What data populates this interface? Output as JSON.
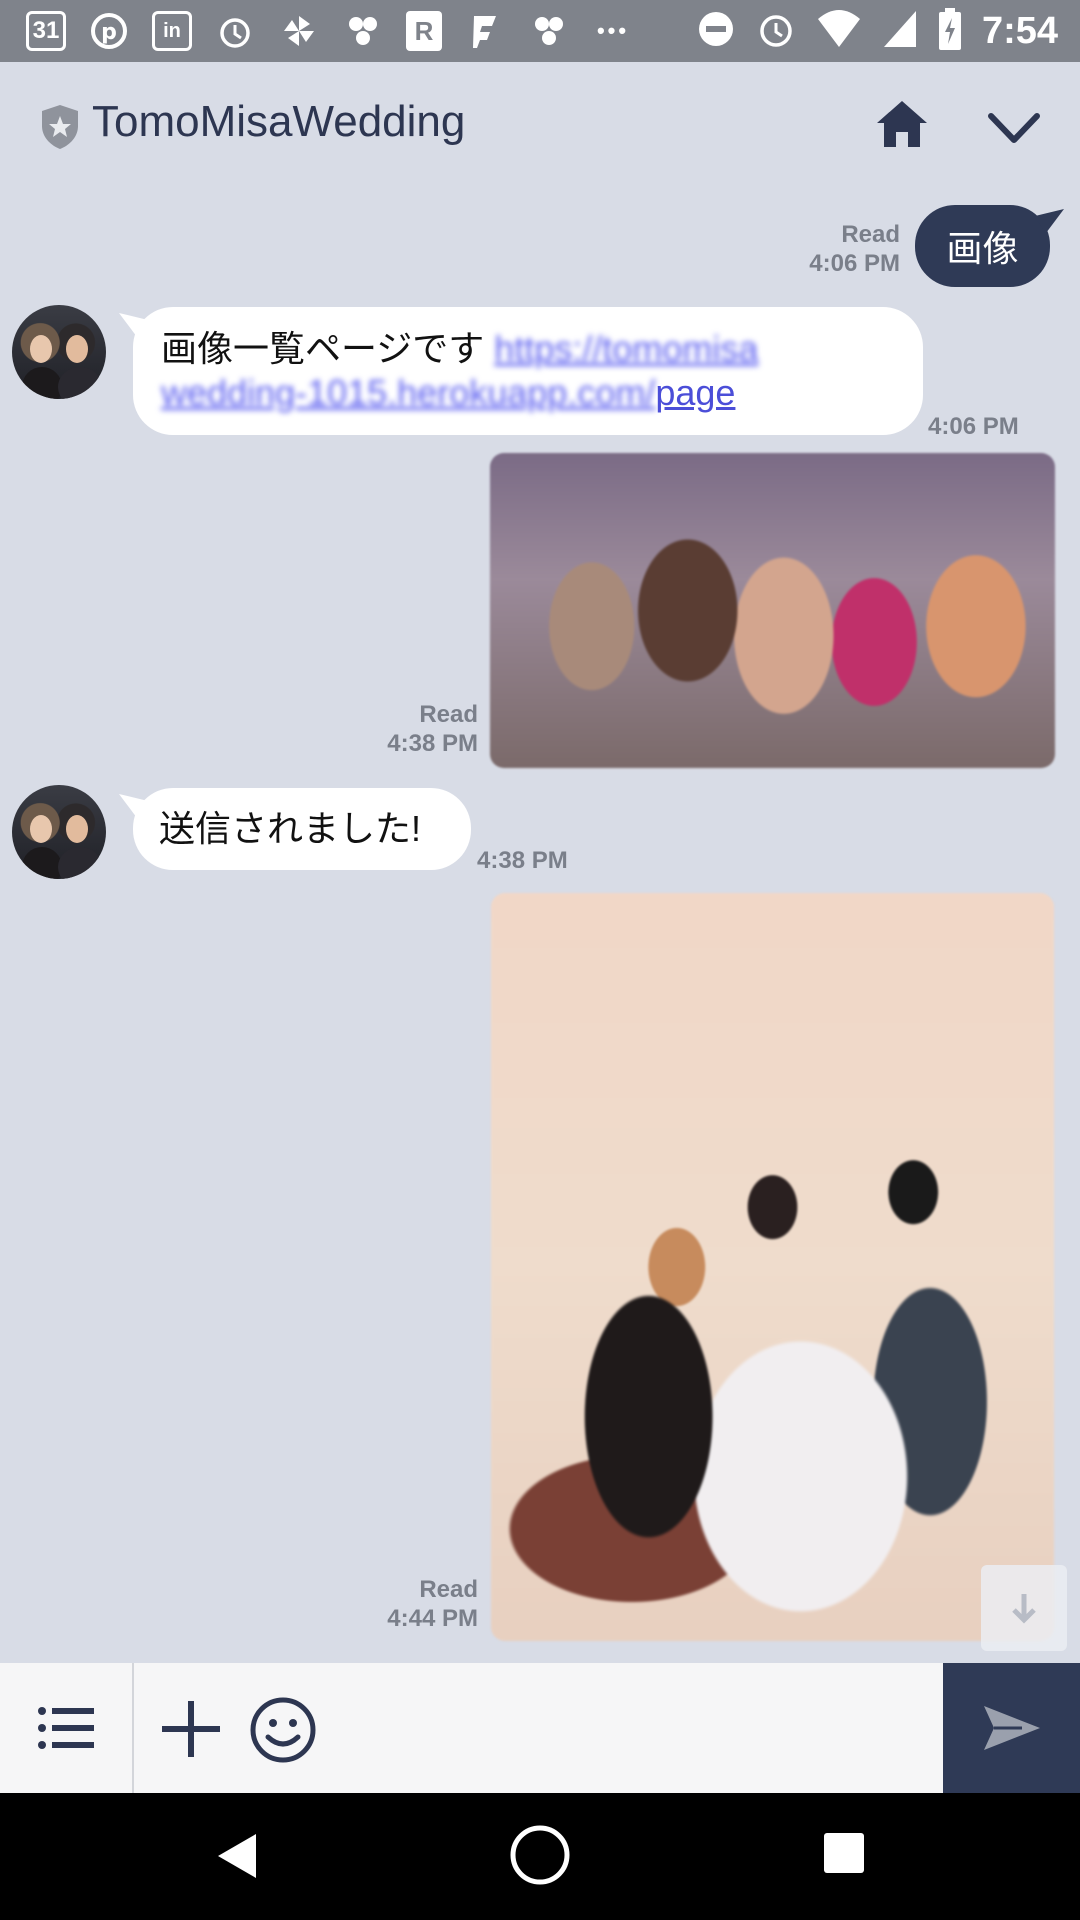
{
  "status_bar": {
    "calendar_date": "31",
    "time": "7:54",
    "left_icons": [
      "calendar-icon",
      "pinterest-icon",
      "linkedin-icon",
      "alarm-icon",
      "pinwheel-icon",
      "flower-icon",
      "r-app-icon",
      "flag-app-icon",
      "flower-icon",
      "more-icon"
    ],
    "right_icons": [
      "do-not-disturb-icon",
      "alarm-icon",
      "wifi-icon",
      "signal-icon",
      "battery-charging-icon"
    ]
  },
  "header": {
    "title": "TomoMisaWedding",
    "shield_icon": "shield-star-icon",
    "home_icon": "home-icon",
    "chevron_icon": "chevron-down-icon"
  },
  "messages": [
    {
      "type": "out-text",
      "text": "画像",
      "status": "Read",
      "time": "4:06 PM"
    },
    {
      "type": "in-text",
      "text": "画像一覧ページです ",
      "link_blurred_1": "https://tomomisa",
      "link_blurred_2": "wedding-1015.herokuapp.com/",
      "link_visible": "page",
      "time": "4:06 PM"
    },
    {
      "type": "out-image",
      "description": "group photo",
      "status": "Read",
      "time": "4:38 PM"
    },
    {
      "type": "in-text",
      "text": "送信されました!",
      "time": "4:38 PM"
    },
    {
      "type": "out-image",
      "description": "wedding photo",
      "status": "Read",
      "time": "4:44 PM"
    }
  ],
  "input_bar": {
    "placeholder": "",
    "menu_icon": "list-menu-icon",
    "plus_icon": "plus-icon",
    "emoji_icon": "emoji-icon",
    "send_icon": "send-icon"
  },
  "colors": {
    "background": "#d8dce6",
    "accent": "#2f3a56",
    "link": "#4b4ed8"
  }
}
